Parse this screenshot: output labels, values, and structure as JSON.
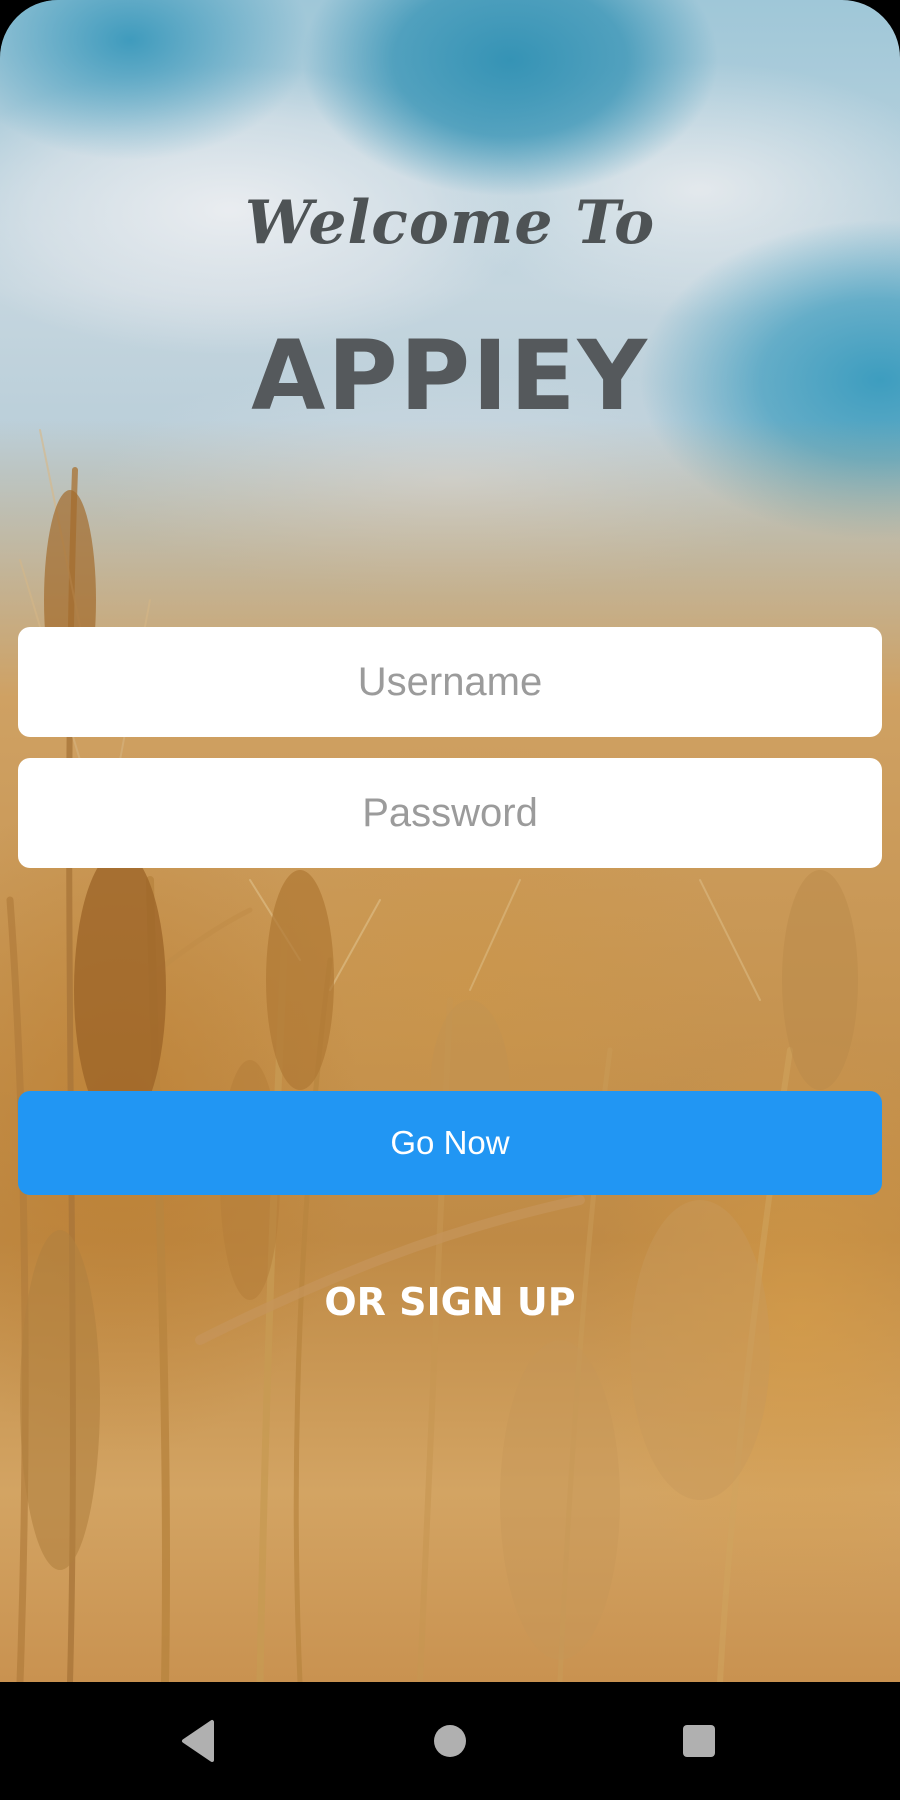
{
  "header": {
    "welcome_text": "Welcome To",
    "app_name": "APPIEY"
  },
  "form": {
    "username_placeholder": "Username",
    "username_value": "",
    "password_placeholder": "Password",
    "password_value": "",
    "submit_label": "Go Now",
    "signup_label": "OR SIGN UP"
  },
  "navigation_bar": {
    "icons": [
      "back-triangle-icon",
      "home-circle-icon",
      "recents-square-icon"
    ]
  },
  "colors": {
    "button_accent": "#2196f3",
    "title_text": "#55595c",
    "input_background": "#ffffff",
    "placeholder_text": "#9b9b9b",
    "nav_bar": "#000000",
    "nav_icon": "#b0b0b0"
  }
}
